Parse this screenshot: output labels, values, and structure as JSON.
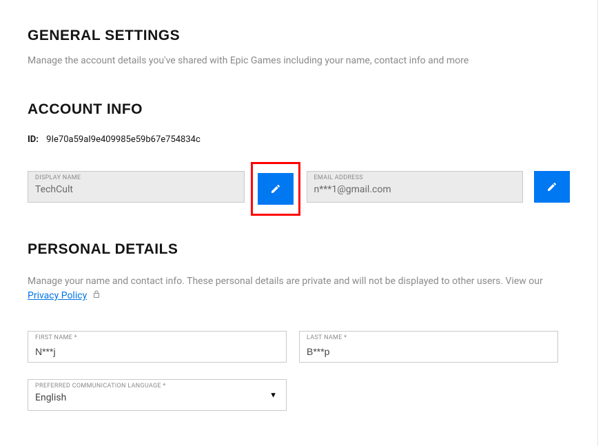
{
  "general": {
    "title": "GENERAL SETTINGS",
    "desc": "Manage the account details you've shared with Epic Games including your name, contact info and more"
  },
  "account": {
    "title": "ACCOUNT INFO",
    "id_label": "ID:",
    "id_value": "9Ie70a59aI9e409985e59b67e754834c",
    "display_name_label": "DISPLAY NAME",
    "display_name_value": "TechCult",
    "email_label": "EMAIL ADDRESS",
    "email_value": "n***1@gmail.com"
  },
  "personal": {
    "title": "PERSONAL DETAILS",
    "desc_part1": "Manage your name and contact info. These personal details are private and will not be displayed to other users. View our ",
    "privacy_link": "Privacy Policy",
    "first_name_label": "FIRST NAME *",
    "first_name_value": "N***j",
    "last_name_label": "LAST NAME *",
    "last_name_value": "B***p",
    "lang_label": "PREFERRED COMMUNICATION LANGUAGE *",
    "lang_value": "English"
  }
}
